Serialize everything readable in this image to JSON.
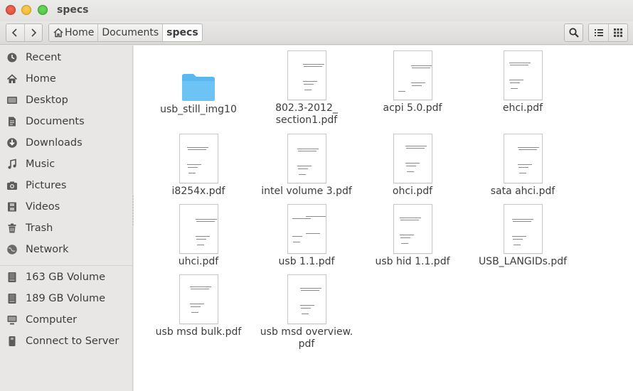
{
  "window": {
    "title": "specs"
  },
  "toolbar": {
    "breadcrumbs": [
      "Home",
      "Documents",
      "specs"
    ]
  },
  "sidebar": {
    "places": [
      {
        "label": "Recent",
        "icon": "clock-icon"
      },
      {
        "label": "Home",
        "icon": "home-icon"
      },
      {
        "label": "Desktop",
        "icon": "desktop-icon"
      },
      {
        "label": "Documents",
        "icon": "documents-icon"
      },
      {
        "label": "Downloads",
        "icon": "download-icon"
      },
      {
        "label": "Music",
        "icon": "music-icon"
      },
      {
        "label": "Pictures",
        "icon": "camera-icon"
      },
      {
        "label": "Videos",
        "icon": "film-icon"
      },
      {
        "label": "Trash",
        "icon": "trash-icon"
      },
      {
        "label": "Network",
        "icon": "network-icon"
      }
    ],
    "devices": [
      {
        "label": "163 GB Volume",
        "icon": "drive-icon"
      },
      {
        "label": "189 GB Volume",
        "icon": "drive-icon"
      },
      {
        "label": "Computer",
        "icon": "computer-icon"
      },
      {
        "label": "Connect to Server",
        "icon": "server-icon"
      }
    ]
  },
  "files": [
    {
      "name": "usb_still_img10",
      "type": "folder"
    },
    {
      "name": "802.3-2012_\nsection1.pdf",
      "type": "pdf"
    },
    {
      "name": "acpi 5.0.pdf",
      "type": "pdf"
    },
    {
      "name": "ehci.pdf",
      "type": "pdf"
    },
    {
      "name": "i8254x.pdf",
      "type": "pdf"
    },
    {
      "name": "intel volume 3.pdf",
      "type": "pdf"
    },
    {
      "name": "ohci.pdf",
      "type": "pdf"
    },
    {
      "name": "sata ahci.pdf",
      "type": "pdf"
    },
    {
      "name": "uhci.pdf",
      "type": "pdf"
    },
    {
      "name": "usb 1.1.pdf",
      "type": "pdf"
    },
    {
      "name": "usb hid 1.1.pdf",
      "type": "pdf"
    },
    {
      "name": "USB_LANGIDs.pdf",
      "type": "pdf"
    },
    {
      "name": "usb msd bulk.pdf",
      "type": "pdf"
    },
    {
      "name": "usb msd overview.\npdf",
      "type": "pdf"
    }
  ],
  "colors": {
    "folder": "#5ab8ef",
    "close": "#e2543f",
    "minimize": "#f2bf3b",
    "maximize": "#5bc94b"
  }
}
